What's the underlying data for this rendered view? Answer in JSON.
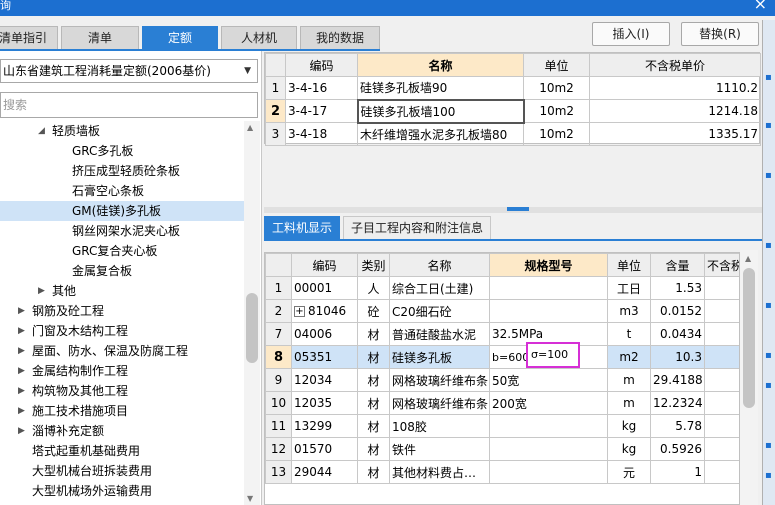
{
  "titlebar": {
    "title": "询",
    "close_glyph": "×"
  },
  "tabs": [
    {
      "label": "清单指引",
      "active": false
    },
    {
      "label": "清单",
      "active": false
    },
    {
      "label": "定额",
      "active": true
    },
    {
      "label": "人材机",
      "active": false
    },
    {
      "label": "我的数据",
      "active": false
    }
  ],
  "buttons": {
    "insert": "插入(I)",
    "replace": "替换(R)"
  },
  "left": {
    "quota_select": "山东省建筑工程消耗量定额(2006基价)",
    "search_placeholder": "搜索",
    "tree": [
      {
        "label": "轻质墙板",
        "expanded": true,
        "selected": false
      },
      {
        "label": "GRC多孔板",
        "selected": false
      },
      {
        "label": "挤压成型轻质砼条板",
        "selected": false
      },
      {
        "label": "石膏空心条板",
        "selected": false
      },
      {
        "label": "GM(硅镁)多孔板",
        "selected": true
      },
      {
        "label": "钢丝网架水泥夹心板",
        "selected": false
      },
      {
        "label": "GRC复合夹心板",
        "selected": false
      },
      {
        "label": "金属复合板",
        "selected": false
      },
      {
        "label": "其他",
        "selected": false
      },
      {
        "label": "钢筋及砼工程",
        "selected": false
      },
      {
        "label": "门窗及木结构工程",
        "selected": false
      },
      {
        "label": "屋面、防水、保温及防腐工程",
        "selected": false
      },
      {
        "label": "金属结构制作工程",
        "selected": false
      },
      {
        "label": "构筑物及其他工程",
        "selected": false
      },
      {
        "label": "施工技术措施项目",
        "selected": false
      },
      {
        "label": "淄博补充定额",
        "selected": false
      },
      {
        "label": "塔式起重机基础费用",
        "selected": false
      },
      {
        "label": "大型机械台班拆装费用",
        "selected": false
      },
      {
        "label": "大型机械场外运输费用",
        "selected": false
      }
    ]
  },
  "quota_table": {
    "headers": {
      "code": "编码",
      "name": "名称",
      "unit": "单位",
      "price": "不含税单价"
    },
    "rows": [
      {
        "no": "1",
        "code": "3-4-16",
        "name": "硅镁多孔板墙90",
        "unit": "10m2",
        "price": "1110.2"
      },
      {
        "no": "2",
        "code": "3-4-17",
        "name": "硅镁多孔板墙100",
        "unit": "10m2",
        "price": "1214.18"
      },
      {
        "no": "3",
        "code": "3-4-18",
        "name": "木纤维增强水泥多孔板墙80",
        "unit": "10m2",
        "price": "1335.17"
      }
    ]
  },
  "bottom_tabs": [
    {
      "label": "工料机显示",
      "active": true
    },
    {
      "label": "子目工程内容和附注信息",
      "active": false
    }
  ],
  "material_table": {
    "headers": {
      "code": "编码",
      "type": "类别",
      "name": "名称",
      "spec": "规格型号",
      "unit": "单位",
      "qty": "含量",
      "price": "不含税"
    },
    "rows": [
      {
        "no": "1",
        "code": "00001",
        "type": "人",
        "name": "综合工日(土建)",
        "spec": "",
        "unit": "工日",
        "qty": "1.53",
        "price": ""
      },
      {
        "no": "2",
        "code": "81046",
        "type": "砼",
        "name": "C20细石砼",
        "spec": "",
        "unit": "m3",
        "qty": "0.0152",
        "price": "22"
      },
      {
        "no": "7",
        "code": "04006",
        "type": "材",
        "name": "普通硅酸盐水泥",
        "spec": "32.5MPa",
        "unit": "t",
        "qty": "0.0434",
        "price": "2"
      },
      {
        "no": "8",
        "code": "05351",
        "type": "材",
        "name": "硅镁多孔板",
        "spec": "b=600",
        "unit": "m2",
        "qty": "10.3",
        "price": "9"
      },
      {
        "no": "9",
        "code": "12034",
        "type": "材",
        "name": "网格玻璃纤维布条",
        "spec": "50宽",
        "unit": "m",
        "qty": "29.4188",
        "price": ""
      },
      {
        "no": "10",
        "code": "12035",
        "type": "材",
        "name": "网格玻璃纤维布条",
        "spec": "200宽",
        "unit": "m",
        "qty": "12.2324",
        "price": ""
      },
      {
        "no": "11",
        "code": "13299",
        "type": "材",
        "name": "108胶",
        "spec": "",
        "unit": "kg",
        "qty": "5.78",
        "price": ""
      },
      {
        "no": "12",
        "code": "01570",
        "type": "材",
        "name": "铁件",
        "spec": "",
        "unit": "kg",
        "qty": "0.5926",
        "price": ""
      },
      {
        "no": "13",
        "code": "29044",
        "type": "材",
        "name": "其他材料费占…",
        "spec": "",
        "unit": "元",
        "qty": "1",
        "price": ""
      }
    ],
    "edit_value": "σ=100"
  }
}
